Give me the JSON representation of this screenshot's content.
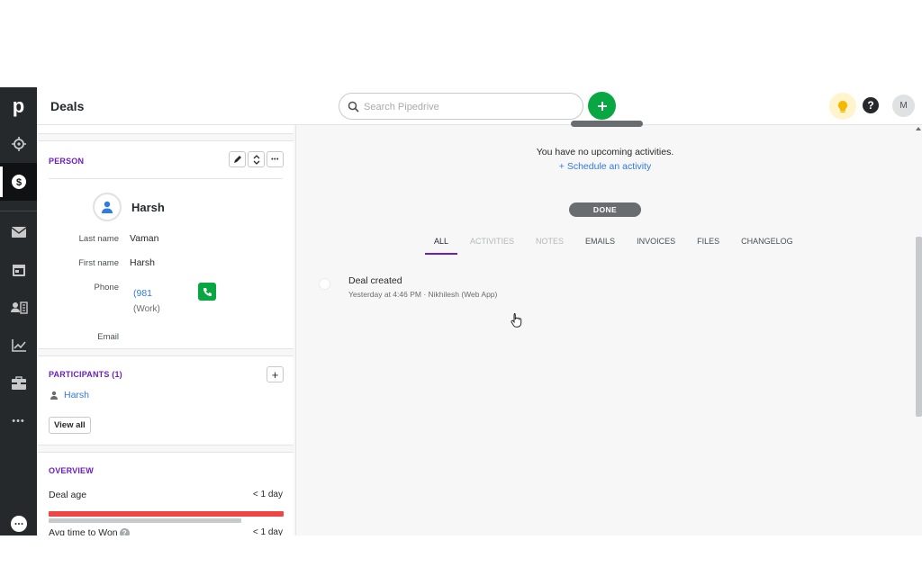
{
  "nav": {
    "logo": "p",
    "items": [
      {
        "name": "target-icon"
      },
      {
        "name": "deals-dollar-icon",
        "active": true
      },
      {
        "name": "mail-icon"
      },
      {
        "name": "calendar-icon"
      },
      {
        "name": "contacts-icon"
      },
      {
        "name": "chart-icon"
      },
      {
        "name": "products-box-icon"
      },
      {
        "name": "more-dots-icon"
      }
    ],
    "more_label": "•••"
  },
  "header": {
    "title": "Deals",
    "search_placeholder": "Search Pipedrive",
    "avatar_initial": "M",
    "help_label": "?"
  },
  "person": {
    "section_title": "PERSON",
    "name": "Harsh",
    "fields": {
      "last_name_label": "Last name",
      "last_name": "Vaman",
      "first_name_label": "First name",
      "first_name": "Harsh",
      "phone_label": "Phone",
      "phone": "(981",
      "phone_type": "(Work)",
      "email_label": "Email"
    },
    "more_label": "•••"
  },
  "participants": {
    "section_title": "PARTICIPANTS (1)",
    "add_label": "+",
    "items": [
      "Harsh"
    ],
    "view_all": "View all"
  },
  "overview": {
    "section_title": "OVERVIEW",
    "deal_age_label": "Deal age",
    "deal_age_value": "< 1 day",
    "avg_won_label": "Avg time to Won",
    "avg_won_value": "< 1 day"
  },
  "activity": {
    "no_upcoming": "You have no upcoming activities.",
    "schedule_link": "+ Schedule an activity",
    "done_label": "DONE",
    "tabs": [
      {
        "label": "ALL",
        "state": "active"
      },
      {
        "label": "ACTIVITIES",
        "state": "disabled"
      },
      {
        "label": "NOTES",
        "state": "disabled"
      },
      {
        "label": "EMAILS",
        "state": "normal"
      },
      {
        "label": "INVOICES",
        "state": "normal"
      },
      {
        "label": "FILES",
        "state": "normal"
      },
      {
        "label": "CHANGELOG",
        "state": "normal"
      }
    ],
    "event": {
      "title": "Deal created",
      "meta": "Yesterday at 4:46 PM  ·  Nikhilesh (Web App)"
    }
  },
  "colors": {
    "accent_purple": "#6b1fc2",
    "add_green": "#08a742",
    "link_blue": "#317ae2",
    "danger_red": "#f04545",
    "rail_dark": "#26292c"
  }
}
